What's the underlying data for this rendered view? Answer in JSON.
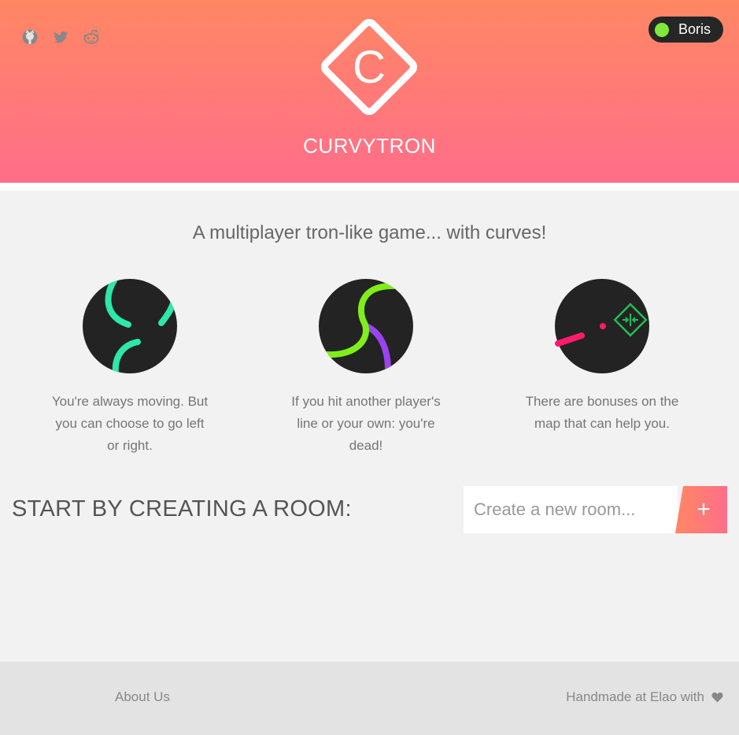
{
  "header": {
    "logo_letter": "C",
    "title": "CURVYTRON",
    "user": {
      "name": "Boris",
      "status_color": "#80e83a"
    }
  },
  "tagline": "A multiplayer tron-like game... with curves!",
  "features": [
    {
      "icon": "turning-curves-illustration",
      "text": "You're always moving. But you can choose to go left or right."
    },
    {
      "icon": "crossing-lines-illustration",
      "text": "If you hit another player's line or your own: you're dead!"
    },
    {
      "icon": "bonus-map-illustration",
      "text": "There are bonuses on the map that can help you."
    }
  ],
  "room": {
    "title": "START BY CREATING A ROOM:",
    "placeholder": "Create a new room...",
    "add_label": "+"
  },
  "footer": {
    "icons": [
      "github-icon",
      "twitter-icon",
      "reddit-icon"
    ],
    "about_label": "About Us",
    "credit": "Handmade at Elao with"
  },
  "colors": {
    "accent_start": "#ff8763",
    "accent_end": "#ff6e8a",
    "dark_circle": "#232323",
    "teal_line": "#2de8a8",
    "green_line": "#80ee1a",
    "purple_line": "#9944ee",
    "pink_line": "#ff1a6e",
    "bonus_green": "#22bb55"
  }
}
